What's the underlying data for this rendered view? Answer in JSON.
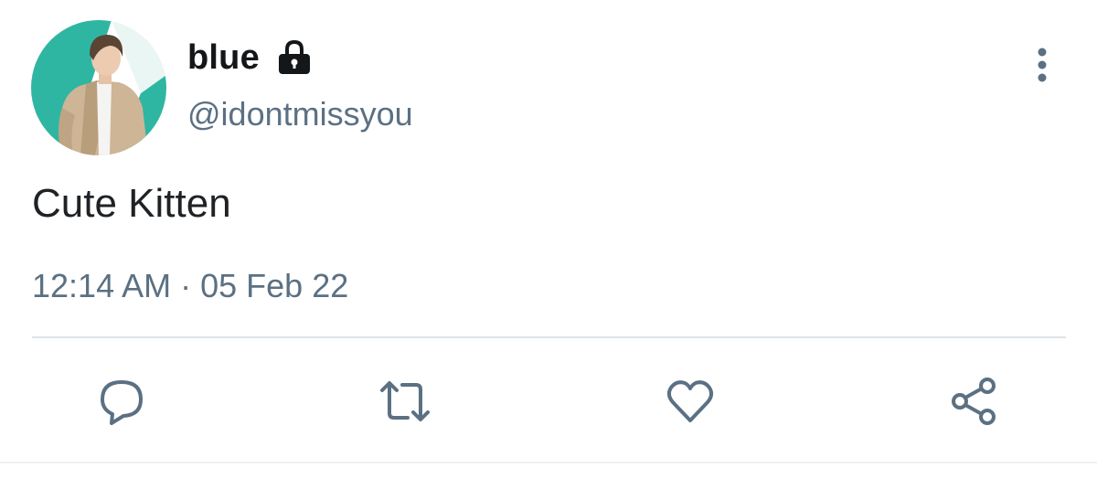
{
  "tweet": {
    "display_name": "blue",
    "handle": "@idontmissyou",
    "text": "Cute Kitten",
    "time": "12:14 AM",
    "separator": "·",
    "date": "05 Feb 22",
    "protected_icon": "lock-icon"
  },
  "actions": [
    {
      "name": "reply",
      "icon": "chat-bubble-icon"
    },
    {
      "name": "retweet",
      "icon": "retweet-arrows-icon"
    },
    {
      "name": "like",
      "icon": "heart-outline-icon"
    },
    {
      "name": "share",
      "icon": "share-nodes-icon"
    }
  ],
  "menu_icon": "more-vertical-icon",
  "colors": {
    "text_primary": "#14171a",
    "text_secondary": "#5b7083",
    "icon": "#5b7083",
    "divider": "#dde3e8",
    "avatar_accent": "#2fb6a3"
  }
}
